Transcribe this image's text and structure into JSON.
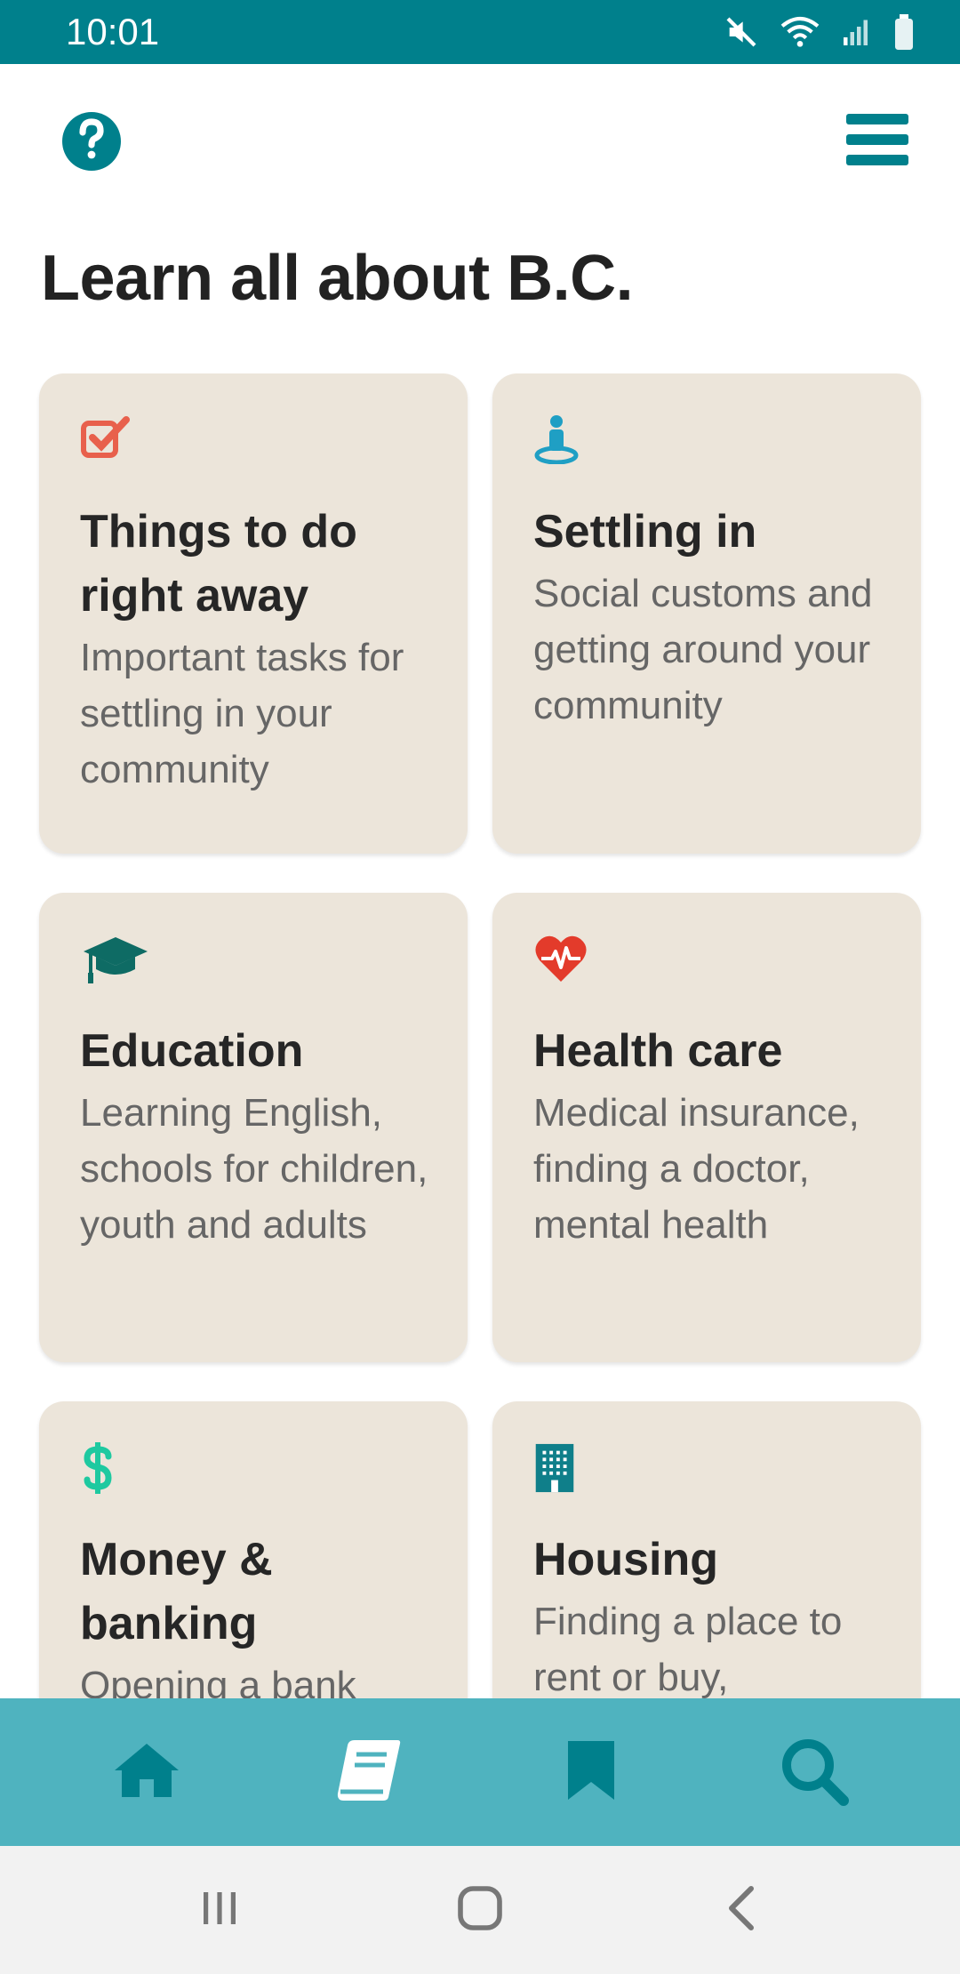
{
  "status_bar": {
    "time": "10:01",
    "icons": [
      "mute-icon",
      "wifi-icon",
      "signal-icon",
      "battery-icon"
    ]
  },
  "header": {
    "help_icon": "question-circle-icon",
    "menu_icon": "hamburger-menu-icon"
  },
  "page": {
    "title": "Learn all about B.C."
  },
  "cards": [
    {
      "title": "Things to do right away",
      "description": "Important tasks for settling in your community",
      "icon": "checkbox-icon",
      "icon_color": "#e8604c"
    },
    {
      "title": "Settling in",
      "description": "Social customs and getting around your community",
      "icon": "person-pin-icon",
      "icon_color": "#1f9fc4"
    },
    {
      "title": "Education",
      "description": "Learning English, schools for children, youth and adults",
      "icon": "graduation-cap-icon",
      "icon_color": "#0e6b64"
    },
    {
      "title": "Health care",
      "description": "Medical insurance, finding a doctor, mental health",
      "icon": "heartbeat-icon",
      "icon_color": "#e33b2b"
    },
    {
      "title": "Money & banking",
      "description": "Opening a bank",
      "icon": "dollar-icon",
      "icon_color": "#1ec9a0"
    },
    {
      "title": "Housing",
      "description": "Finding a place to rent or buy,",
      "icon": "building-icon",
      "icon_color": "#0f7f8a"
    }
  ],
  "bottom_nav": {
    "items": [
      "home-icon",
      "book-icon",
      "bookmark-icon",
      "search-icon"
    ],
    "active": "book-icon",
    "color": "#00808c"
  },
  "system_nav": {
    "items": [
      "recent-apps-icon",
      "home-button-icon",
      "back-icon"
    ]
  },
  "colors": {
    "primary": "#00808c",
    "card_background": "#ece5da",
    "bottom_nav_background": "#4fb3bf"
  }
}
